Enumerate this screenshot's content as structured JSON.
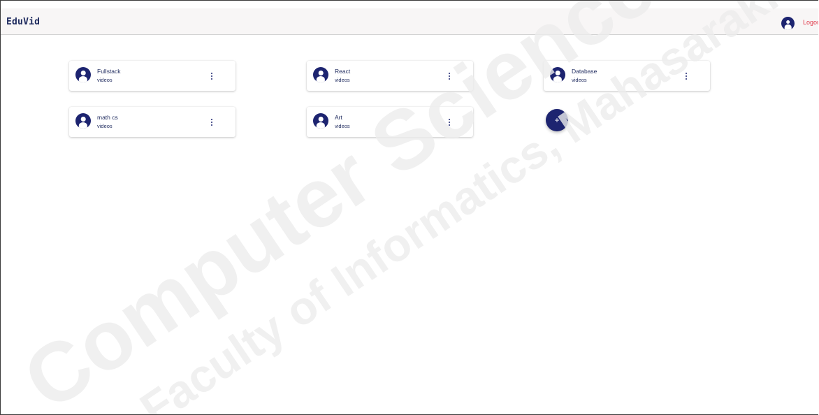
{
  "header": {
    "brand": "EduVid",
    "logout_label": "Logou"
  },
  "courses": [
    {
      "title": "Fullstack",
      "subtitle": "videos"
    },
    {
      "title": "React",
      "subtitle": "videos"
    },
    {
      "title": "Database",
      "subtitle": "videos"
    },
    {
      "title": "math cs",
      "subtitle": "videos"
    },
    {
      "title": "Art",
      "subtitle": "videos"
    }
  ],
  "add_button": {
    "label": "+"
  },
  "watermark": {
    "line1": "Computer Science",
    "line2": "Faculty of Informatics, Mahasarakham"
  },
  "colors": {
    "primary": "#1d2470",
    "logout": "#e0384a",
    "text": "#1e2a5e"
  }
}
